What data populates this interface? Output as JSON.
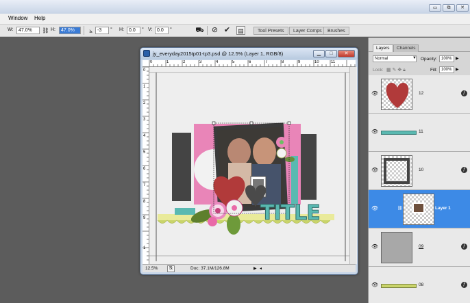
{
  "menu": {
    "window": "Window",
    "help": "Help"
  },
  "window_controls": {
    "min": "▭",
    "restore": "⧉",
    "close": "✕"
  },
  "options": {
    "w_label": "W:",
    "w_value": "47.0%",
    "h_label": "H:",
    "h_value": "47.0%",
    "angle_value": "-3",
    "angle_unit": "°",
    "hskew_label": "H:",
    "hskew_value": "0.0",
    "hskew_unit": "°",
    "vskew_label": "V:",
    "vskew_value": "0.0",
    "vskew_unit": "°",
    "tabs": [
      "Tool Presets",
      "Layer Comps",
      "Brushes"
    ]
  },
  "document": {
    "title": "jy_everyday2015tp01-tp3.psd @ 12.5% (Layer 1, RGB/8)",
    "ruler_top": [
      "0",
      "1",
      "2",
      "3",
      "4",
      "5",
      "6",
      "7",
      "8",
      "9",
      "10",
      "11"
    ],
    "ruler_left": [
      "0",
      "1",
      "2",
      "3",
      "4",
      "5",
      "6",
      "7",
      "8",
      "9",
      "1"
    ],
    "zoom": "12.5%",
    "doc_size": "Doc: 37.1M/126.8M",
    "canvas_title_text": "TITLE"
  },
  "panel": {
    "tab_layers": "Layers",
    "tab_channels": "Channels",
    "blend_mode": "Normal",
    "opacity_label": "Opacity:",
    "opacity_value": "100%",
    "lock_label": "Lock:",
    "fill_label": "Fill:",
    "fill_value": "100%",
    "layers": [
      {
        "name": "12"
      },
      {
        "name": "11"
      },
      {
        "name": "10"
      },
      {
        "name": "Layer 1"
      },
      {
        "name": "09"
      },
      {
        "name": "08"
      }
    ]
  },
  "colors": {
    "selection_blue": "#3d8ae6",
    "paper_pink": "#e985b8",
    "paper_dark": "#444444",
    "teal": "#5ab9b1",
    "heart_red": "#b13a3a",
    "scallop_green": "#c9d46a"
  }
}
